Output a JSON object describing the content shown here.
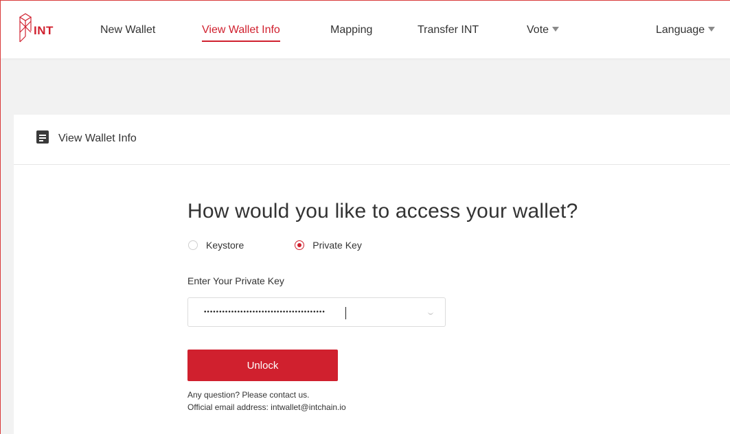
{
  "header": {
    "logo_text": "INT",
    "nav": [
      {
        "label": "New Wallet"
      },
      {
        "label": "View Wallet Info",
        "active": true
      },
      {
        "label": "Mapping"
      },
      {
        "label": "Transfer INT"
      },
      {
        "label": "Vote"
      }
    ],
    "language_label": "Language"
  },
  "card": {
    "title": "View Wallet Info",
    "question": "How would you like to access your wallet?",
    "options": [
      {
        "label": "Keystore",
        "checked": false
      },
      {
        "label": "Private Key",
        "checked": true
      }
    ],
    "field_label": "Enter Your Private Key",
    "private_key_value": "••••••••••••••••••••••••••••••••••••••••",
    "unlock_label": "Unlock",
    "help_line1": "Any question? Please contact us.",
    "help_line2": "Official email address: intwallet@intchain.io"
  },
  "colors": {
    "accent": "#d0202e",
    "text": "#333333",
    "background": "#f2f2f2"
  }
}
